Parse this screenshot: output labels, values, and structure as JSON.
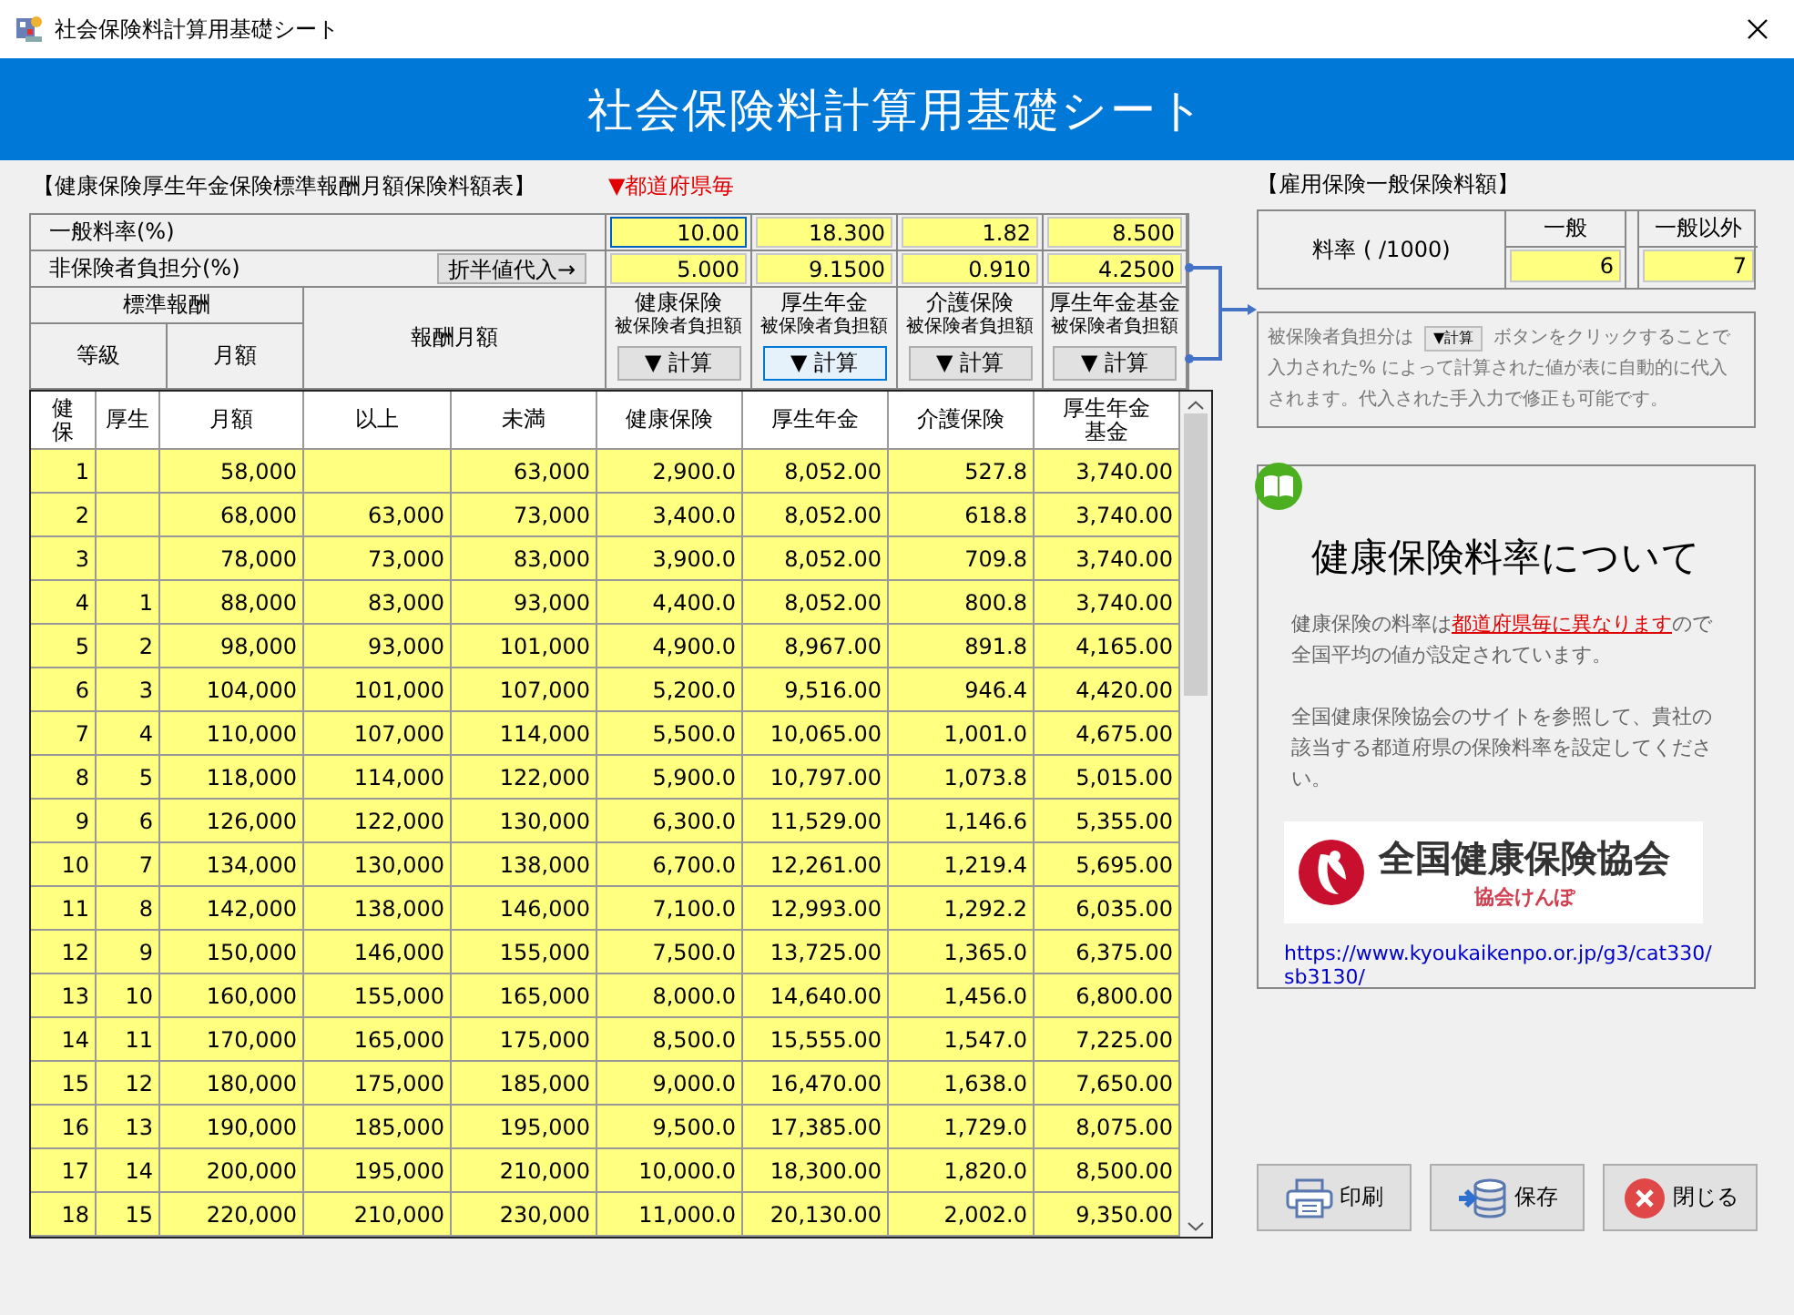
{
  "window": {
    "title": "社会保険料計算用基礎シート"
  },
  "header": {
    "title": "社会保険料計算用基礎シート"
  },
  "premium": {
    "title": "【健康保険厚生年金保険標準報酬月額保険料額表】",
    "note": "▼都道府県毎",
    "rate_rows": [
      {
        "label": "一般料率(%)",
        "fields": [
          {
            "value": "10.00",
            "focused": true
          },
          {
            "value": "18.300",
            "focused": false
          },
          {
            "value": "1.82",
            "focused": false
          },
          {
            "value": "8.500",
            "focused": false
          }
        ]
      },
      {
        "label": "非保険者負担分(%)",
        "button": "折半値代入→",
        "fields": [
          {
            "value": "5.000",
            "focused": false
          },
          {
            "value": "9.1500",
            "focused": false
          },
          {
            "value": "0.910",
            "focused": false
          },
          {
            "value": "4.2500",
            "focused": false
          }
        ]
      }
    ],
    "standard": {
      "title": "標準報酬",
      "grade": "等級",
      "monthly": "月額"
    },
    "remuneration": "報酬月額",
    "insurances": [
      {
        "name": "健康保険",
        "sub": "被保険者負担額",
        "button": "▼ 計算",
        "highlighted": false
      },
      {
        "name": "厚生年金",
        "sub": "被保険者負担額",
        "button": "▼ 計算",
        "highlighted": true
      },
      {
        "name": "介護保険",
        "sub": "被保険者負担額",
        "button": "▼ 計算",
        "highlighted": false
      },
      {
        "name": "厚生年金基金",
        "sub": "被保険者負担額",
        "button": "▼ 計算",
        "highlighted": false
      }
    ],
    "columns": [
      "健保",
      "厚生",
      "月額",
      "以上",
      "未満",
      "健康保険",
      "厚生年金",
      "介護保険",
      "厚生年金基金"
    ],
    "rows": [
      [
        "1",
        null,
        "58,000",
        null,
        "63,000",
        "2,900.0",
        "8,052.00",
        "527.8",
        "3,740.00"
      ],
      [
        "2",
        null,
        "68,000",
        "63,000",
        "73,000",
        "3,400.0",
        "8,052.00",
        "618.8",
        "3,740.00"
      ],
      [
        "3",
        null,
        "78,000",
        "73,000",
        "83,000",
        "3,900.0",
        "8,052.00",
        "709.8",
        "3,740.00"
      ],
      [
        "4",
        "1",
        "88,000",
        "83,000",
        "93,000",
        "4,400.0",
        "8,052.00",
        "800.8",
        "3,740.00"
      ],
      [
        "5",
        "2",
        "98,000",
        "93,000",
        "101,000",
        "4,900.0",
        "8,967.00",
        "891.8",
        "4,165.00"
      ],
      [
        "6",
        "3",
        "104,000",
        "101,000",
        "107,000",
        "5,200.0",
        "9,516.00",
        "946.4",
        "4,420.00"
      ],
      [
        "7",
        "4",
        "110,000",
        "107,000",
        "114,000",
        "5,500.0",
        "10,065.00",
        "1,001.0",
        "4,675.00"
      ],
      [
        "8",
        "5",
        "118,000",
        "114,000",
        "122,000",
        "5,900.0",
        "10,797.00",
        "1,073.8",
        "5,015.00"
      ],
      [
        "9",
        "6",
        "126,000",
        "122,000",
        "130,000",
        "6,300.0",
        "11,529.00",
        "1,146.6",
        "5,355.00"
      ],
      [
        "10",
        "7",
        "134,000",
        "130,000",
        "138,000",
        "6,700.0",
        "12,261.00",
        "1,219.4",
        "5,695.00"
      ],
      [
        "11",
        "8",
        "142,000",
        "138,000",
        "146,000",
        "7,100.0",
        "12,993.00",
        "1,292.2",
        "6,035.00"
      ],
      [
        "12",
        "9",
        "150,000",
        "146,000",
        "155,000",
        "7,500.0",
        "13,725.00",
        "1,365.0",
        "6,375.00"
      ],
      [
        "13",
        "10",
        "160,000",
        "155,000",
        "165,000",
        "8,000.0",
        "14,640.00",
        "1,456.0",
        "6,800.00"
      ],
      [
        "14",
        "11",
        "170,000",
        "165,000",
        "175,000",
        "8,500.0",
        "15,555.00",
        "1,547.0",
        "7,225.00"
      ],
      [
        "15",
        "12",
        "180,000",
        "175,000",
        "185,000",
        "9,000.0",
        "16,470.00",
        "1,638.0",
        "7,650.00"
      ],
      [
        "16",
        "13",
        "190,000",
        "185,000",
        "195,000",
        "9,500.0",
        "17,385.00",
        "1,729.0",
        "8,075.00"
      ],
      [
        "17",
        "14",
        "200,000",
        "195,000",
        "210,000",
        "10,000.0",
        "18,300.00",
        "1,820.0",
        "8,500.00"
      ],
      [
        "18",
        "15",
        "220,000",
        "210,000",
        "230,000",
        "11,000.0",
        "20,130.00",
        "2,002.0",
        "9,350.00"
      ]
    ]
  },
  "employment": {
    "title": "【雇用保険一般保険料額】",
    "label": "料率 ( /1000)",
    "columns": [
      {
        "heading": "一般",
        "value": "6"
      },
      {
        "heading": "一般以外",
        "value": "7"
      }
    ]
  },
  "info_note": {
    "before": "被保険者負担分は",
    "button": "▼計算",
    "after": "ボタンをクリックすることで入力された% によって計算された値が表に自動的に代入されます。代入された手入力で修正も可能です。"
  },
  "rate_panel": {
    "title": "健康保険料率について",
    "paragraphs": [
      "健康保険の料率は**都道府県毎に異なります**ので全国平均の値が設定されています。",
      "全国健康保険協会のサイトを参照して、貴社の該当する都道府県の保険料率を設定してください。"
    ],
    "logo": {
      "name": "全国健康保険協会",
      "subtitle": "協会けんぽ"
    },
    "link": "https://www.kyoukaikenpo.or.jp/g3/cat330/sb3130/"
  },
  "actions": [
    {
      "label": "印刷",
      "kind": "print"
    },
    {
      "label": "保存",
      "kind": "save"
    },
    {
      "label": "閉じる",
      "kind": "close"
    }
  ]
}
